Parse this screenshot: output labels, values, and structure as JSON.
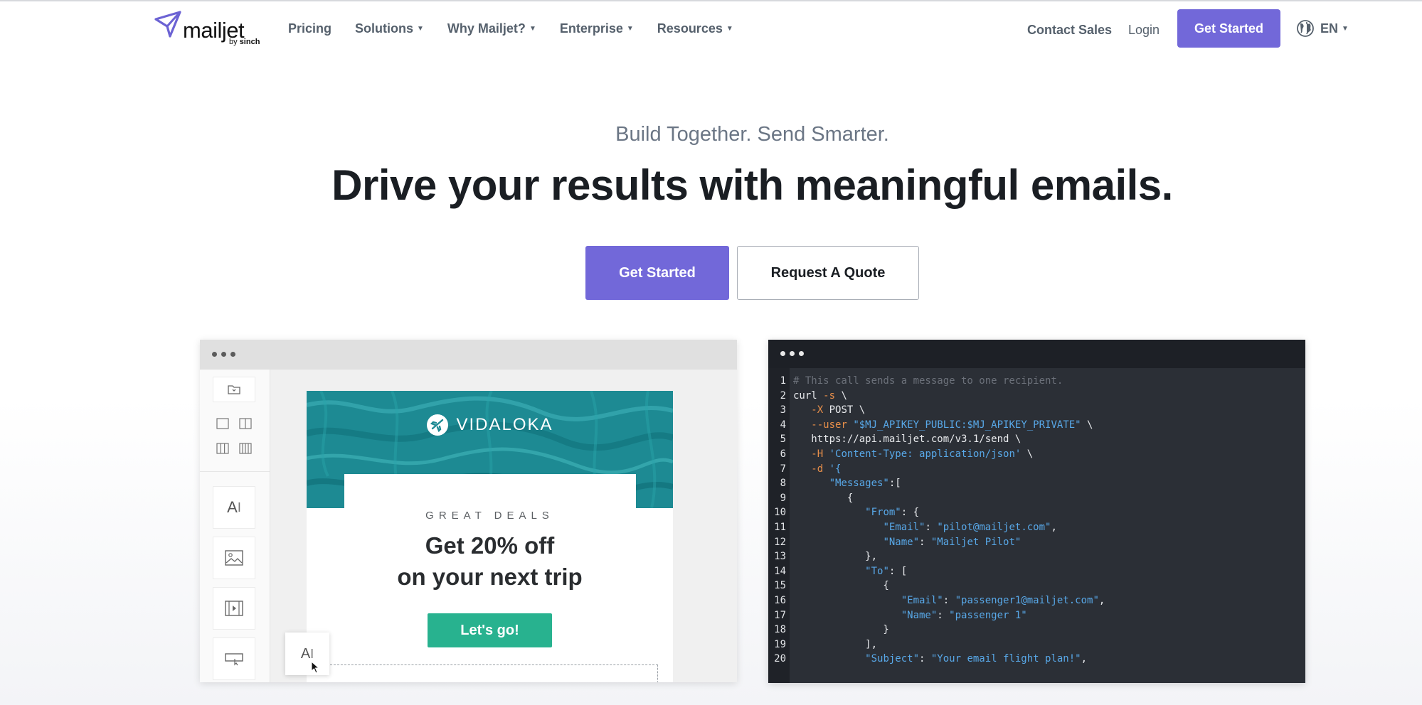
{
  "nav": {
    "logo_text": "mailjet",
    "logo_sub_prefix": "by",
    "logo_sub_brand": "sinch",
    "items": [
      {
        "label": "Pricing",
        "dropdown": false
      },
      {
        "label": "Solutions",
        "dropdown": true
      },
      {
        "label": "Why Mailjet?",
        "dropdown": true
      },
      {
        "label": "Enterprise",
        "dropdown": true
      },
      {
        "label": "Resources",
        "dropdown": true
      }
    ],
    "contact_sales": "Contact Sales",
    "login": "Login",
    "get_started": "Get Started",
    "language": "EN",
    "language_icon": "globe-icon"
  },
  "hero": {
    "tagline": "Build Together. Send Smarter.",
    "headline": "Drive your results with meaningful emails.",
    "primary_button": "Get Started",
    "secondary_button": "Request A Quote"
  },
  "editor_demo": {
    "brand": "VIDALOKA",
    "eyebrow": "GREAT DEALS",
    "offer_line1": "Get 20% off",
    "offer_line2": "on your next trip",
    "cta": "Let's go!",
    "tools": [
      "folder-icon",
      "layout-1col-icon",
      "layout-2col-icon",
      "layout-3col-icon",
      "layout-4col-icon",
      "text-block-icon",
      "image-block-icon",
      "video-block-icon",
      "button-block-icon"
    ],
    "text_tool_label": "A",
    "dragging_label": "A"
  },
  "code_demo": {
    "lines": [
      "# This call sends a message to one recipient.",
      "curl -s \\",
      "   -X POST \\",
      "   --user \"$MJ_APIKEY_PUBLIC:$MJ_APIKEY_PRIVATE\" \\",
      "   https://api.mailjet.com/v3.1/send \\",
      "   -H 'Content-Type: application/json' \\",
      "   -d '{",
      "      \"Messages\":[",
      "         {",
      "            \"From\": {",
      "               \"Email\": \"pilot@mailjet.com\",",
      "               \"Name\": \"Mailjet Pilot\"",
      "            },",
      "            \"To\": [",
      "               {",
      "                  \"Email\": \"passenger1@mailjet.com\",",
      "                  \"Name\": \"passenger 1\"",
      "               }",
      "            ],",
      "            \"Subject\": \"Your email flight plan!\","
    ]
  },
  "colors": {
    "accent": "#7268d9",
    "cta_green": "#28b28f",
    "code_bg": "#2b2f36",
    "code_string": "#58a8e8"
  }
}
